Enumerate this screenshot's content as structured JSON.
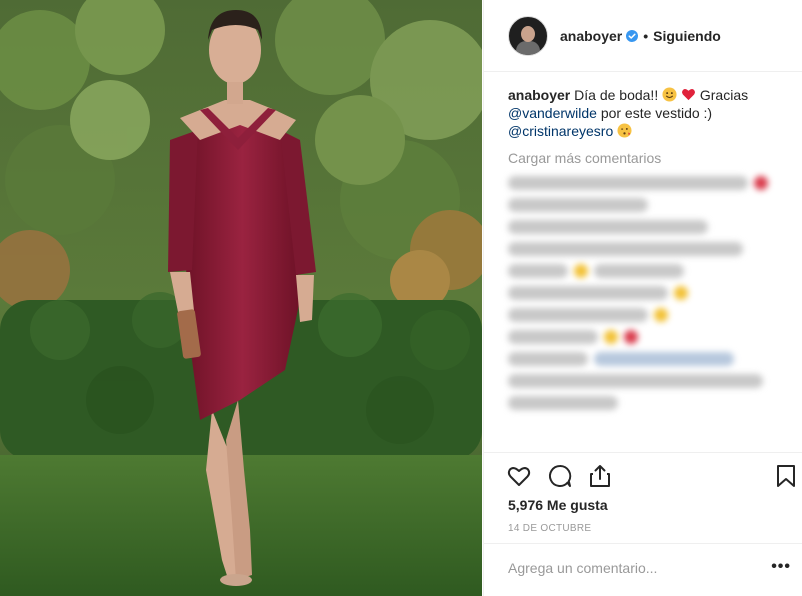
{
  "post": {
    "username": "anaboyer",
    "separator": "•",
    "follow_status": "Siguiendo",
    "caption": {
      "username": "anaboyer",
      "text_1": "Día de boda!!",
      "text_2": "Gracias",
      "mention_1": "@vanderwilde",
      "text_3": "por este vestido :)",
      "mention_2": "@cristinareyesro"
    },
    "load_more": "Cargar más comentarios",
    "likes": "5,976 Me gusta",
    "date": "14 DE OCTUBRE",
    "comment_placeholder": "Agrega un comentario...",
    "more_options": "•••"
  },
  "icons": {
    "verified": "verified-badge-icon",
    "like": "heart-icon",
    "comment": "comment-icon",
    "share": "share-icon",
    "save": "bookmark-icon"
  },
  "colors": {
    "verified_blue": "#3897f0",
    "mention": "#003569",
    "muted": "#999999",
    "dress": "#8a1e36"
  }
}
